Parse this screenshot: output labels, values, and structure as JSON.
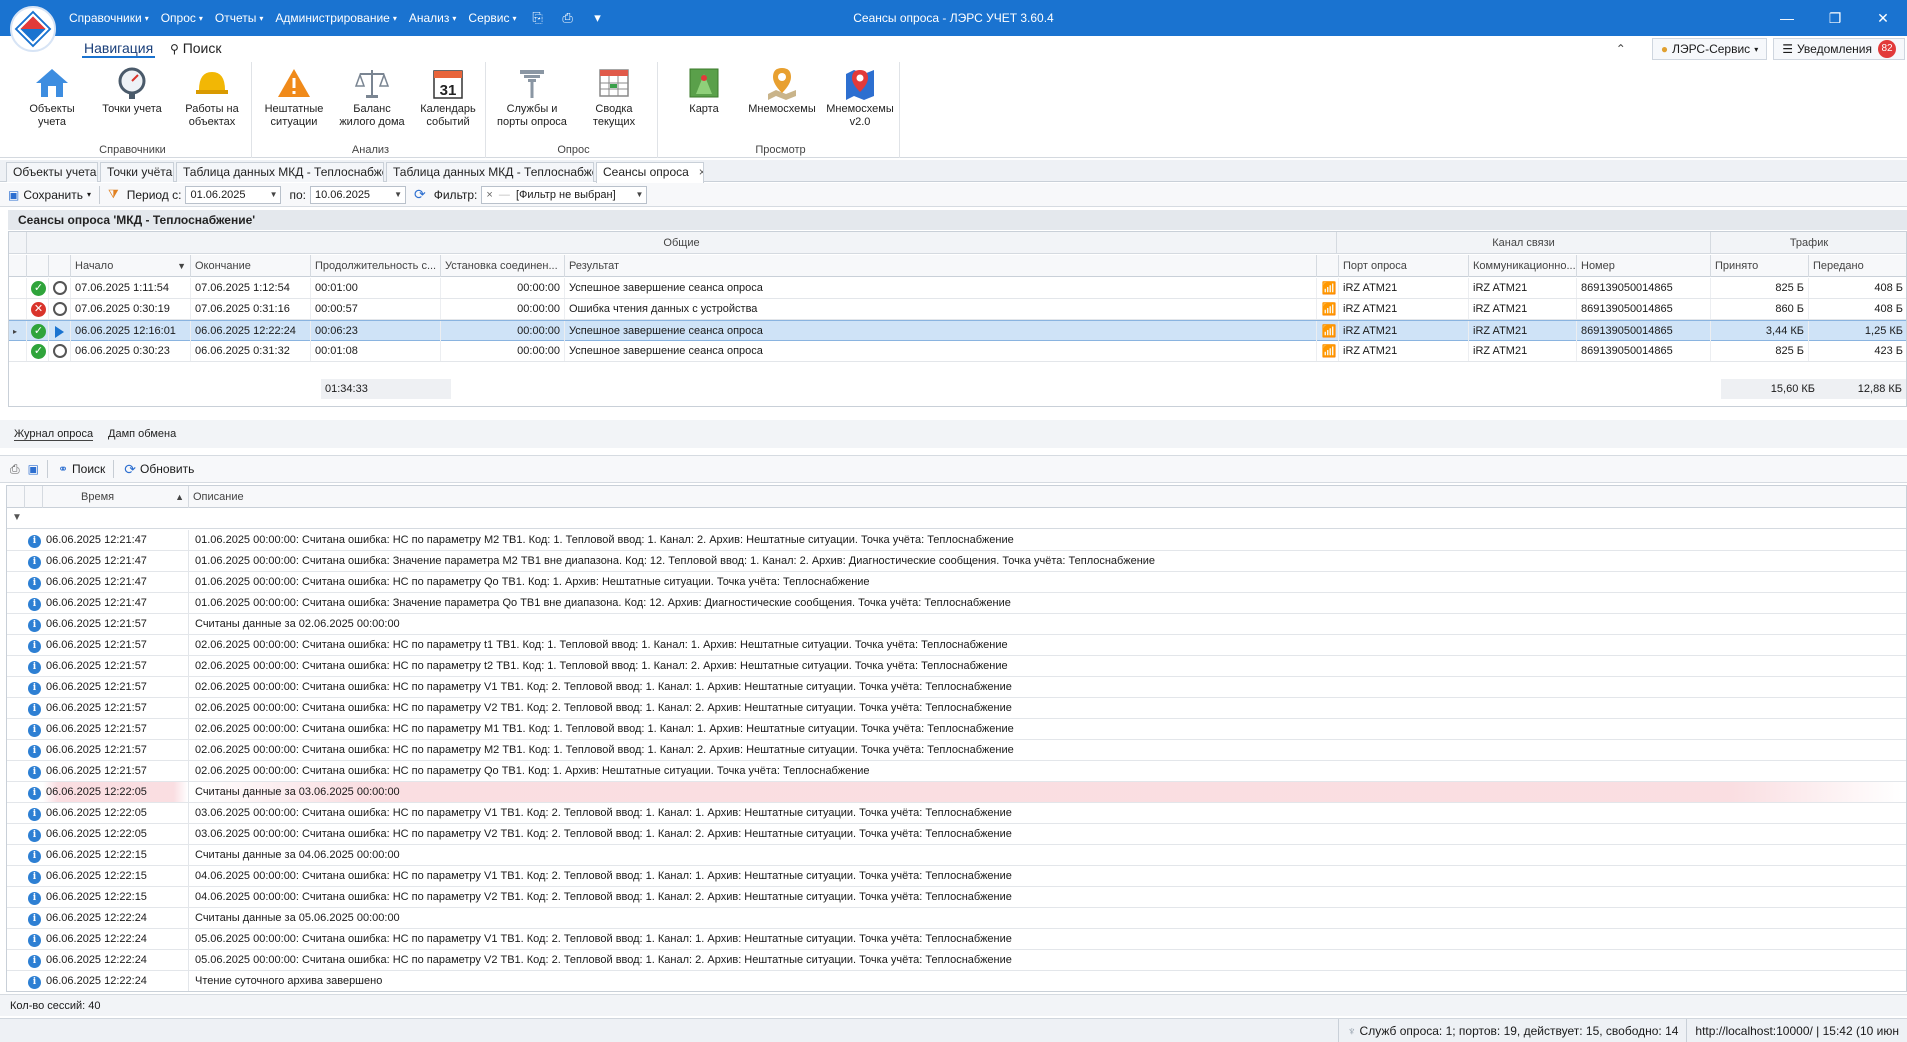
{
  "window": {
    "title": "Сеансы опроса - ЛЭРС УЧЕТ 3.60.4",
    "controls": {
      "minimize": "—",
      "restore": "❐",
      "close": "✕"
    }
  },
  "menu": [
    {
      "label": "Справочники"
    },
    {
      "label": "Опрос"
    },
    {
      "label": "Отчеты"
    },
    {
      "label": "Администрирование"
    },
    {
      "label": "Анализ"
    },
    {
      "label": "Сервис"
    }
  ],
  "ribbon_tabs": {
    "navigation": "Навигация",
    "search": "Поиск"
  },
  "ribbon_right": {
    "collapse": "⌃",
    "user": "ЛЭРС-Сервис",
    "notifications": "Уведомления",
    "notifications_count": "82"
  },
  "ribbon_groups": [
    {
      "label": "Справочники",
      "buttons": [
        "Объекты учета",
        "Точки учета",
        "Работы на объектах"
      ]
    },
    {
      "label": "Анализ",
      "buttons": [
        "Нештатные ситуации",
        "Баланс жилого дома",
        "Календарь событий"
      ]
    },
    {
      "label": "Опрос",
      "buttons": [
        "Службы и порты опроса",
        "Сводка текущих"
      ]
    },
    {
      "label": "Просмотр",
      "buttons": [
        "Карта",
        "Мнемосхемы",
        "Мнемосхемы v2.0"
      ]
    }
  ],
  "calendar_day": "31",
  "doc_tabs": [
    {
      "label": "Объекты учета"
    },
    {
      "label": "Точки учёта"
    },
    {
      "label": "Таблица данных МКД - Теплоснабжение"
    },
    {
      "label": "Таблица данных МКД - Теплоснабжение"
    },
    {
      "label": "Сеансы опроса",
      "close": "×"
    }
  ],
  "filter_bar": {
    "save": "Сохранить",
    "period_from_label": "Период с:",
    "period_from": "01.06.2025",
    "period_to_label": "по:",
    "period_to": "10.06.2025",
    "filter_label": "Фильтр:",
    "filter_value": "[Фильтр не выбран]",
    "filter_clear": "×",
    "filter_mid": "—"
  },
  "sessions": {
    "caption": "Сеансы опроса 'МКД - Теплоснабжение'",
    "bands": {
      "general": "Общие",
      "channel": "Канал связи",
      "traffic": "Трафик"
    },
    "columns": {
      "start": "Начало",
      "end": "Окончание",
      "duration": "Продолжительность с...",
      "connect": "Установка соединен...",
      "result": "Результат",
      "port": "Порт опроса",
      "comm": "Коммуникационно...",
      "number": "Номер",
      "received": "Принято",
      "sent": "Передано"
    },
    "rows": [
      {
        "status": "ok",
        "type": "clock",
        "start": "07.06.2025 1:11:54",
        "end": "07.06.2025 1:12:54",
        "duration": "00:01:00",
        "connect": "00:00:00",
        "result": "Успешное завершение сеанса опроса",
        "port": "iRZ ATM21",
        "comm": "iRZ ATM21",
        "number": "869139050014865",
        "received": "825 Б",
        "sent": "408 Б"
      },
      {
        "status": "err",
        "type": "clock",
        "start": "07.06.2025 0:30:19",
        "end": "07.06.2025 0:31:16",
        "duration": "00:00:57",
        "connect": "00:00:00",
        "result": "Ошибка чтения данных с устройства",
        "port": "iRZ ATM21",
        "comm": "iRZ ATM21",
        "number": "869139050014865",
        "received": "860 Б",
        "sent": "408 Б"
      },
      {
        "status": "ok",
        "type": "play",
        "start": "06.06.2025 12:16:01",
        "end": "06.06.2025 12:22:24",
        "duration": "00:06:23",
        "connect": "00:00:00",
        "result": "Успешное завершение сеанса опроса",
        "port": "iRZ ATM21",
        "comm": "iRZ ATM21",
        "number": "869139050014865",
        "received": "3,44 КБ",
        "sent": "1,25 КБ",
        "selected": true
      },
      {
        "status": "ok",
        "type": "clock",
        "start": "06.06.2025 0:30:23",
        "end": "06.06.2025 0:31:32",
        "duration": "00:01:08",
        "connect": "00:00:00",
        "result": "Успешное завершение сеанса опроса",
        "port": "iRZ ATM21",
        "comm": "iRZ ATM21",
        "number": "869139050014865",
        "received": "825 Б",
        "sent": "423 Б"
      }
    ],
    "totals": {
      "duration": "01:34:33",
      "received": "15,60 КБ",
      "sent": "12,88 КБ"
    }
  },
  "sub_tabs": {
    "journal": "Журнал опроса",
    "dump": "Дамп обмена"
  },
  "log_toolbar": {
    "search": "Поиск",
    "refresh": "Обновить"
  },
  "log": {
    "columns": {
      "time": "Время",
      "description": "Описание"
    },
    "rows": [
      {
        "time": "06.06.2025 12:21:47",
        "text": "01.06.2025 00:00:00: Считана ошибка: НС по параметру M2 ТВ1. Код: 1. Тепловой ввод: 1. Канал: 2. Архив: Нештатные ситуации. Точка учёта: Теплоснабжение"
      },
      {
        "time": "06.06.2025 12:21:47",
        "text": "01.06.2025 00:00:00: Считана ошибка: Значение параметра M2 ТВ1 вне диапазона. Код: 12. Тепловой ввод: 1. Канал: 2. Архив: Диагностические сообщения. Точка учёта: Теплоснабжение"
      },
      {
        "time": "06.06.2025 12:21:47",
        "text": "01.06.2025 00:00:00: Считана ошибка: НС по параметру Qo ТВ1. Код: 1. Архив: Нештатные ситуации. Точка учёта: Теплоснабжение"
      },
      {
        "time": "06.06.2025 12:21:47",
        "text": "01.06.2025 00:00:00: Считана ошибка: Значение параметра Qo ТВ1 вне диапазона. Код: 12. Архив: Диагностические сообщения. Точка учёта: Теплоснабжение"
      },
      {
        "time": "06.06.2025 12:21:57",
        "text": "Считаны данные за 02.06.2025 00:00:00"
      },
      {
        "time": "06.06.2025 12:21:57",
        "text": "02.06.2025 00:00:00: Считана ошибка: НС по параметру t1 ТВ1. Код: 1. Тепловой ввод: 1. Канал: 1. Архив: Нештатные ситуации. Точка учёта: Теплоснабжение"
      },
      {
        "time": "06.06.2025 12:21:57",
        "text": "02.06.2025 00:00:00: Считана ошибка: НС по параметру t2 ТВ1. Код: 1. Тепловой ввод: 1. Канал: 2. Архив: Нештатные ситуации. Точка учёта: Теплоснабжение"
      },
      {
        "time": "06.06.2025 12:21:57",
        "text": "02.06.2025 00:00:00: Считана ошибка: НС по параметру V1 ТВ1. Код: 2. Тепловой ввод: 1. Канал: 1. Архив: Нештатные ситуации. Точка учёта: Теплоснабжение"
      },
      {
        "time": "06.06.2025 12:21:57",
        "text": "02.06.2025 00:00:00: Считана ошибка: НС по параметру V2 ТВ1. Код: 2. Тепловой ввод: 1. Канал: 2. Архив: Нештатные ситуации. Точка учёта: Теплоснабжение"
      },
      {
        "time": "06.06.2025 12:21:57",
        "text": "02.06.2025 00:00:00: Считана ошибка: НС по параметру M1 ТВ1. Код: 1. Тепловой ввод: 1. Канал: 1. Архив: Нештатные ситуации. Точка учёта: Теплоснабжение"
      },
      {
        "time": "06.06.2025 12:21:57",
        "text": "02.06.2025 00:00:00: Считана ошибка: НС по параметру M2 ТВ1. Код: 1. Тепловой ввод: 1. Канал: 2. Архив: Нештатные ситуации. Точка учёта: Теплоснабжение"
      },
      {
        "time": "06.06.2025 12:21:57",
        "text": "02.06.2025 00:00:00: Считана ошибка: НС по параметру Qo ТВ1. Код: 1. Архив: Нештатные ситуации. Точка учёта: Теплоснабжение"
      },
      {
        "time": "06.06.2025 12:22:05",
        "text": "Считаны данные за 03.06.2025 00:00:00",
        "highlight": true
      },
      {
        "time": "06.06.2025 12:22:05",
        "text": "03.06.2025 00:00:00: Считана ошибка: НС по параметру V1 ТВ1. Код: 2. Тепловой ввод: 1. Канал: 1. Архив: Нештатные ситуации. Точка учёта: Теплоснабжение"
      },
      {
        "time": "06.06.2025 12:22:05",
        "text": "03.06.2025 00:00:00: Считана ошибка: НС по параметру V2 ТВ1. Код: 2. Тепловой ввод: 1. Канал: 2. Архив: Нештатные ситуации. Точка учёта: Теплоснабжение"
      },
      {
        "time": "06.06.2025 12:22:15",
        "text": "Считаны данные за 04.06.2025 00:00:00"
      },
      {
        "time": "06.06.2025 12:22:15",
        "text": "04.06.2025 00:00:00: Считана ошибка: НС по параметру V1 ТВ1. Код: 2. Тепловой ввод: 1. Канал: 1. Архив: Нештатные ситуации. Точка учёта: Теплоснабжение"
      },
      {
        "time": "06.06.2025 12:22:15",
        "text": "04.06.2025 00:00:00: Считана ошибка: НС по параметру V2 ТВ1. Код: 2. Тепловой ввод: 1. Канал: 2. Архив: Нештатные ситуации. Точка учёта: Теплоснабжение"
      },
      {
        "time": "06.06.2025 12:22:24",
        "text": "Считаны данные за 05.06.2025 00:00:00"
      },
      {
        "time": "06.06.2025 12:22:24",
        "text": "05.06.2025 00:00:00: Считана ошибка: НС по параметру V1 ТВ1. Код: 2. Тепловой ввод: 1. Канал: 1. Архив: Нештатные ситуации. Точка учёта: Теплоснабжение"
      },
      {
        "time": "06.06.2025 12:22:24",
        "text": "05.06.2025 00:00:00: Считана ошибка: НС по параметру V2 ТВ1. Код: 2. Тепловой ввод: 1. Канал: 2. Архив: Нештатные ситуации. Точка учёта: Теплоснабжение"
      },
      {
        "time": "06.06.2025 12:22:24",
        "text": "Чтение суточного архива завершено"
      }
    ]
  },
  "status": {
    "sessions_count": "Кол-во сессий: 40",
    "service": "Служб опроса: 1; портов: 19, действует: 15, свободно: 14",
    "server": "http://localhost:10000/ | 15:42 (10 июн"
  },
  "colors": {
    "accent": "#1a73d0",
    "ok": "#2fa43b",
    "error": "#d9342b",
    "selected_row": "#cfe3f7"
  }
}
